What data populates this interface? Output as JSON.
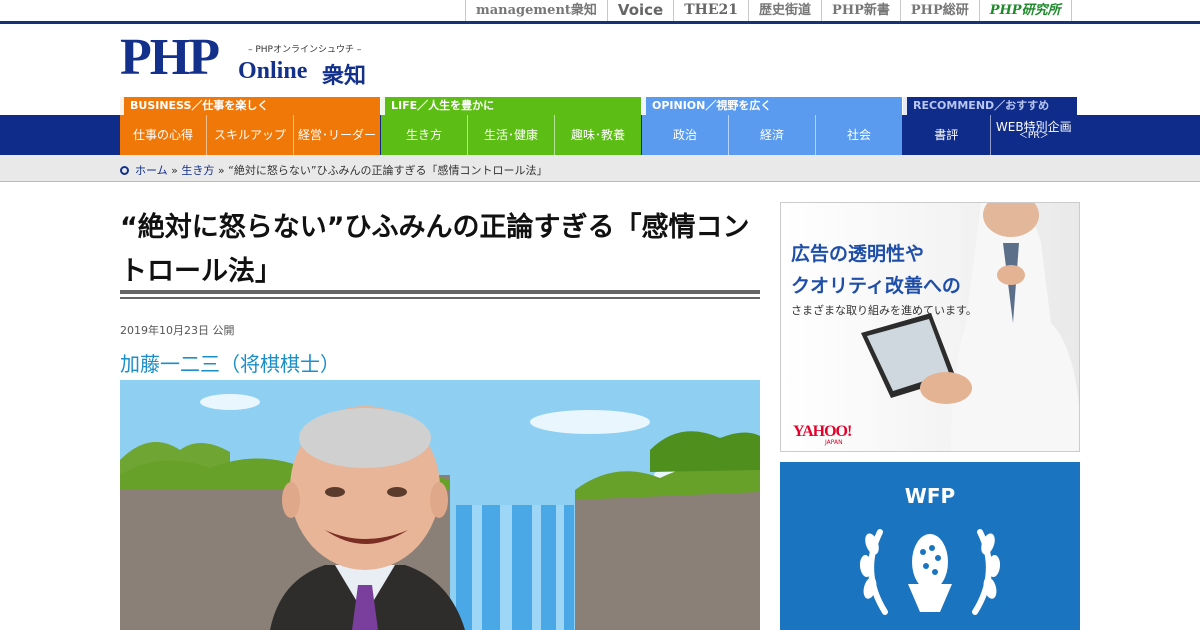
{
  "topnav": [
    "management衆知",
    "Voice",
    "THE21",
    "歴史街道",
    "PHP新書",
    "PHP総研",
    "PHP研究所"
  ],
  "logo": {
    "main": "PHP",
    "sub": "– PHPオンラインシュウチ –",
    "online": "Online",
    "shuchi": "衆知"
  },
  "nav": [
    {
      "head": "BUSINESS／仕事を楽しく",
      "items": [
        "仕事の心得",
        "スキルアップ",
        "経営･リーダー"
      ]
    },
    {
      "head": "LIFE／人生を豊かに",
      "items": [
        "生き方",
        "生活･健康",
        "趣味･教養"
      ]
    },
    {
      "head": "OPINION／視野を広く",
      "items": [
        "政治",
        "経済",
        "社会"
      ]
    },
    {
      "head": "RECOMMEND／おすすめ",
      "items": [
        "書評",
        "WEB特別企画"
      ],
      "pr": "＜PR＞"
    }
  ],
  "breadcrumb": {
    "home": "ホーム",
    "sep": "»",
    "category": "生き方",
    "current": "“絶対に怒らない”ひふみんの正論すぎる「感情コントロール法」"
  },
  "article": {
    "title": "“絶対に怒らない”ひふみんの正論すぎる「感情コントロール法」",
    "date": "2019年10月23日 公開",
    "author": "加藤一二三（将棋棋士）"
  },
  "ads": {
    "yahoo": {
      "line1": "広告の透明性や",
      "line2": "クオリティ改善への",
      "line3": "さまざまな取り組みを進めています。",
      "logo": "YAHOO!",
      "logo_sub": "JAPAN"
    },
    "wfp": {
      "text": "WFP"
    }
  }
}
